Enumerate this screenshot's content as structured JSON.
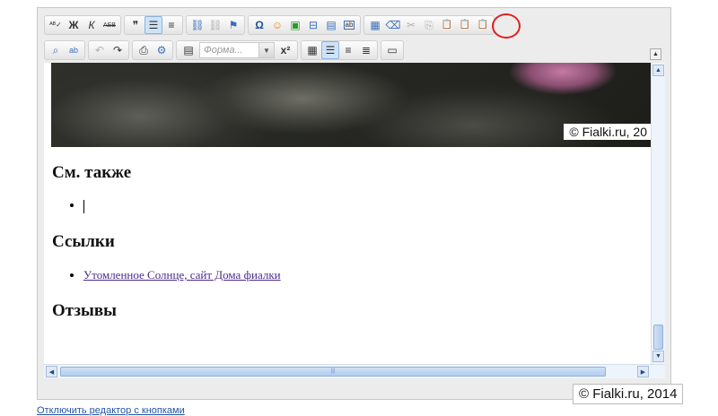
{
  "toolbar": {
    "row1": [
      {
        "name": "spellcheck-icon",
        "glyph": "ᴬᴮ✓"
      },
      {
        "name": "bold-icon",
        "glyph": "Ж"
      },
      {
        "name": "italic-icon",
        "glyph": "К"
      },
      {
        "name": "strikethrough-icon",
        "glyph": "АБВ"
      },
      {
        "name": "blockquote-icon",
        "glyph": "❞"
      },
      {
        "name": "bullet-list-icon",
        "glyph": "☰"
      },
      {
        "name": "numbered-list-icon",
        "glyph": "≡"
      },
      {
        "name": "link-icon",
        "glyph": "⛓"
      },
      {
        "name": "unlink-icon",
        "glyph": "⛓"
      },
      {
        "name": "anchor-flag-icon",
        "glyph": "⚑"
      },
      {
        "name": "special-char-icon",
        "glyph": "Ω"
      },
      {
        "name": "smiley-icon",
        "glyph": "☺"
      },
      {
        "name": "image-icon",
        "glyph": "▣"
      },
      {
        "name": "table-icon",
        "glyph": "⊟"
      },
      {
        "name": "media-icon",
        "glyph": "▤"
      },
      {
        "name": "textfield-icon",
        "glyph": "ab"
      },
      {
        "name": "source-icon",
        "glyph": "▦"
      },
      {
        "name": "eraser-icon",
        "glyph": "⌫"
      },
      {
        "name": "cut-icon",
        "glyph": "✂"
      },
      {
        "name": "copy-icon",
        "glyph": "⎘"
      },
      {
        "name": "paste-icon",
        "glyph": "📋"
      },
      {
        "name": "paste-text-icon",
        "glyph": "📋"
      },
      {
        "name": "paste-word-icon",
        "glyph": "📋"
      }
    ],
    "format_select": {
      "value": "Форма...",
      "arrow": "▼"
    },
    "superscript": "x²",
    "collapse": "▲"
  },
  "content": {
    "photo_caption": "© Fialki.ru, 20",
    "see_also_heading": "См. также",
    "links_heading": "Ссылки",
    "link_text": "Утомленное Солнце, сайт Дома фиалки",
    "reviews_heading": "Отзывы"
  },
  "scrollbars": {
    "up": "▲",
    "down": "▼",
    "left": "◀",
    "right": "▶",
    "grip": "|||"
  },
  "watermark": "© Fialki.ru, 2014",
  "bottom_link": "Отключить редактор с кнопками"
}
